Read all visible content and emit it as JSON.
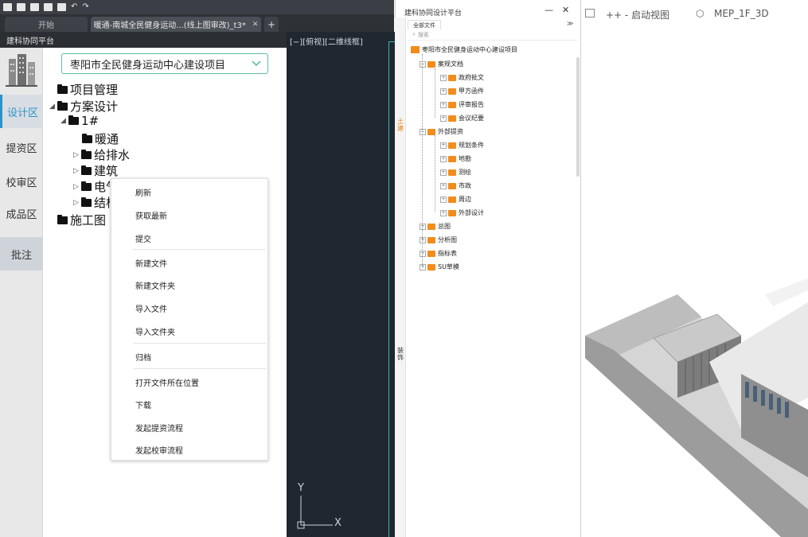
{
  "toolbar": {
    "undo_glyph": "↶",
    "redo_glyph": "↷"
  },
  "tabs": {
    "start": "开始",
    "active": "暖通-南城全民健身运动...(线上图审改)_t3*",
    "close": "✕",
    "add": "+"
  },
  "left_panel": {
    "header": "建科协同平台",
    "rail": [
      "设计区",
      "提资区",
      "校审区",
      "成品区",
      "批注"
    ],
    "project_select": "枣阳市全民健身运动中心建设项目",
    "tree": {
      "n1": "项目管理",
      "n2": "方案设计",
      "n3": "1#",
      "n4": "暖通",
      "n5": "给排水",
      "n6": "建筑",
      "n7": "电气",
      "n8": "结构",
      "n9": "施工图"
    }
  },
  "context_menu": {
    "items": [
      "刷新",
      "获取最新",
      "提交",
      "新建文件",
      "新建文件夹",
      "导入文件",
      "导入文件夹",
      "归档",
      "打开文件所在位置",
      "下载",
      "发起提资流程",
      "发起校审流程"
    ]
  },
  "cad_view": {
    "label": "[−][俯视][二维线框]",
    "axis_y": "Y",
    "axis_x": "X"
  },
  "mid_panel": {
    "title": "建科协同设计平台",
    "minimize": "—",
    "close": "✕",
    "files_tab": "全部文件",
    "expand": "≫",
    "search_placeholder": "搜索",
    "vtab1": "土建",
    "vtab2": "装饰",
    "root": "枣阳市全民健身运动中心建设项目",
    "g1": "案规文档",
    "g1_items": [
      "政府批文",
      "甲方函件",
      "评审报告",
      "会议纪要"
    ],
    "g2": "外部提资",
    "g2_items": [
      "规划条件",
      "地勘",
      "测绘",
      "市政",
      "周边",
      "外部设计"
    ],
    "others": [
      "总图",
      "分析图",
      "指标表",
      "SU草模"
    ]
  },
  "viewport": {
    "tab_a": "++ - 启动视图",
    "tab_b": "MEP_1F_3D"
  },
  "colors": {
    "accent": "#2a94c8",
    "folder": "#f28c1c",
    "select_border": "#5fbfa7",
    "cad_bg": "#1f2731"
  }
}
